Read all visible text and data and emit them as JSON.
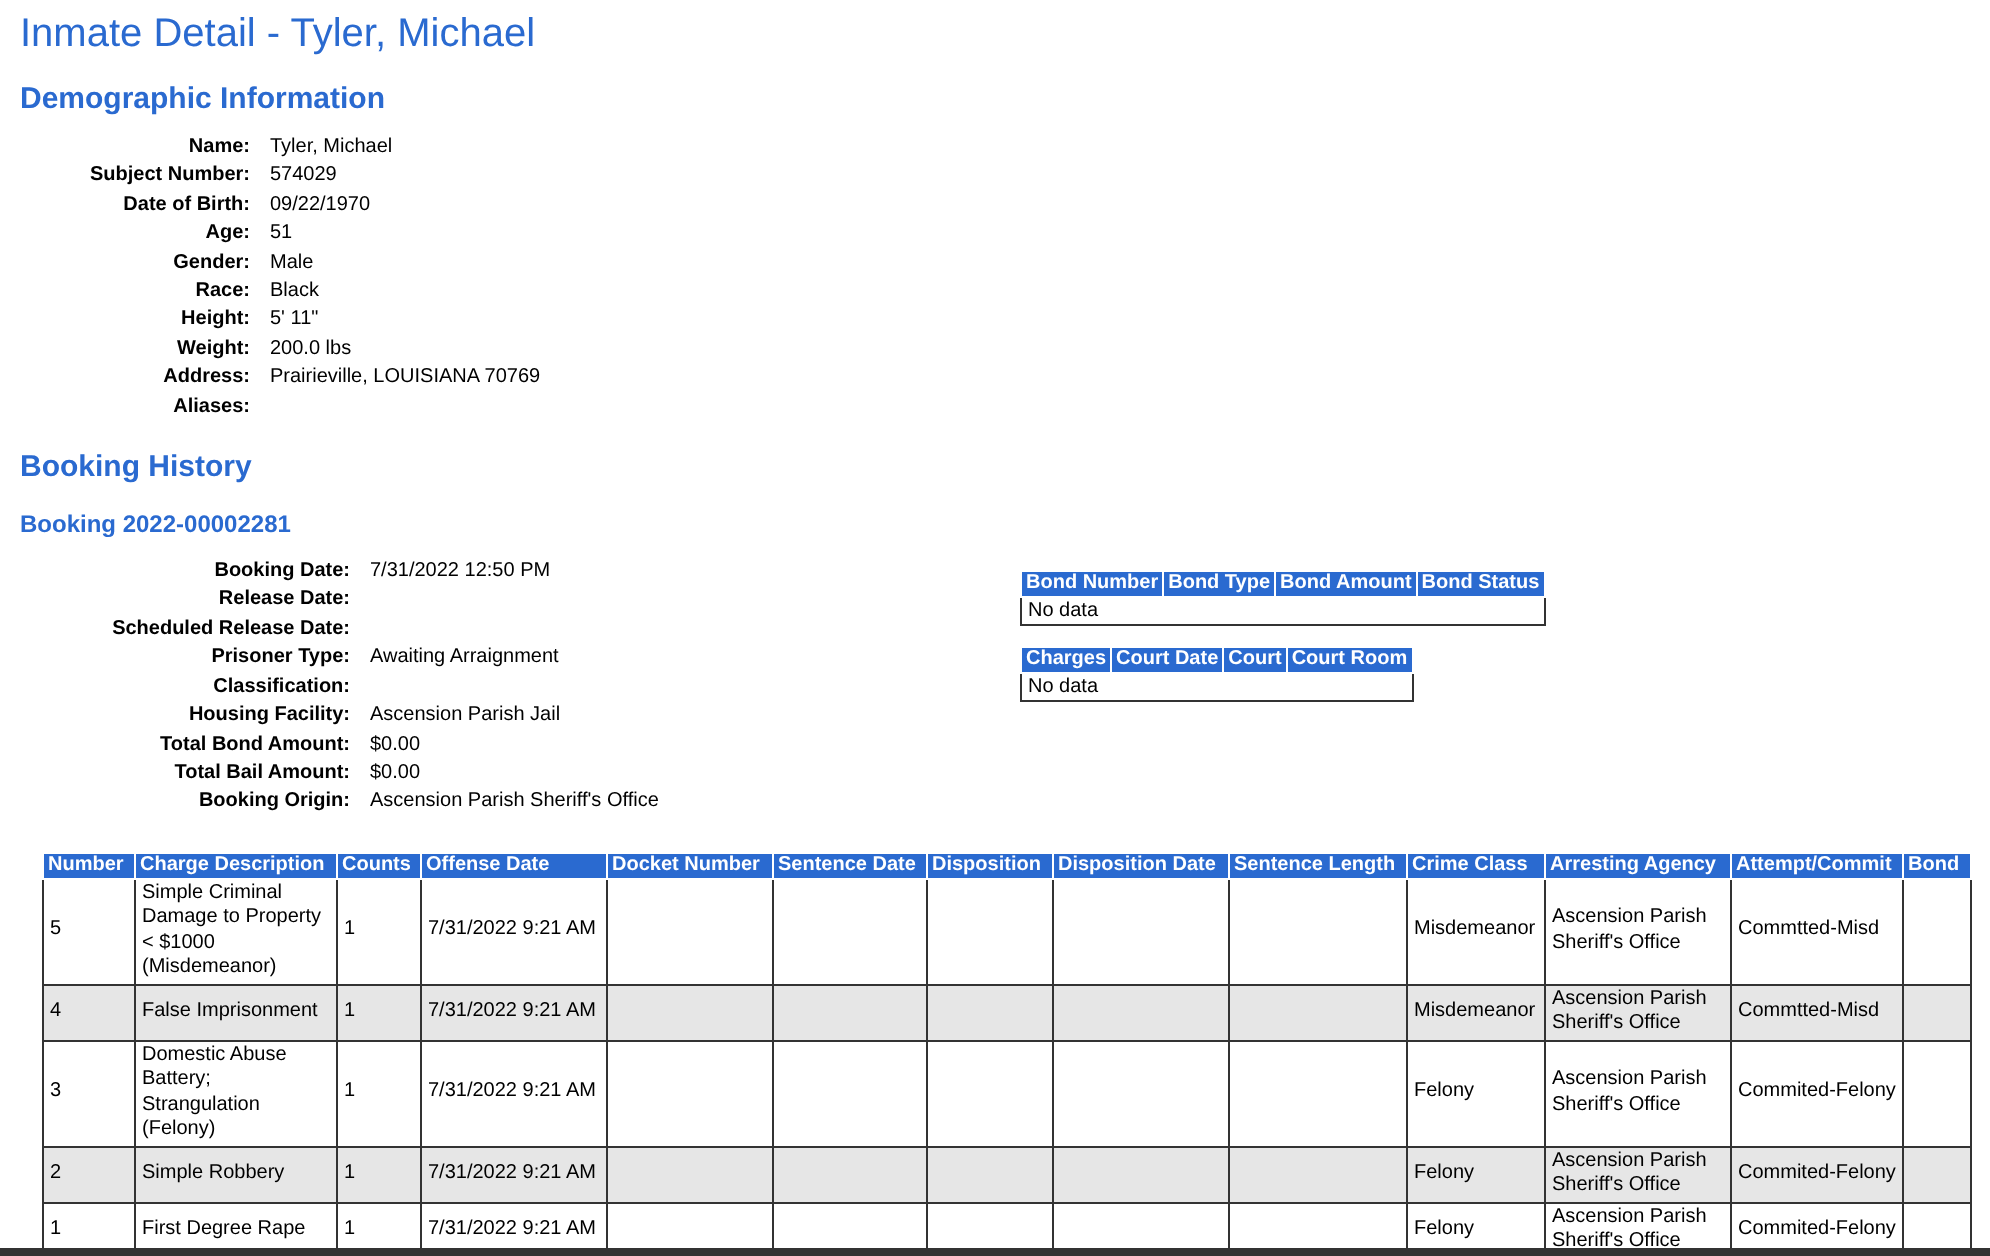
{
  "title": "Inmate Detail - Tyler, Michael",
  "demographics": {
    "heading": "Demographic Information",
    "fields": [
      {
        "label": "Name:",
        "value": "Tyler, Michael"
      },
      {
        "label": "Subject Number:",
        "value": "574029"
      },
      {
        "label": "Date of Birth:",
        "value": "09/22/1970"
      },
      {
        "label": "Age:",
        "value": "51"
      },
      {
        "label": "Gender:",
        "value": "Male"
      },
      {
        "label": "Race:",
        "value": "Black"
      },
      {
        "label": "Height:",
        "value": "5' 11\""
      },
      {
        "label": "Weight:",
        "value": "200.0 lbs"
      },
      {
        "label": "Address:",
        "value": "Prairieville, LOUISIANA 70769"
      },
      {
        "label": "Aliases:"
      }
    ]
  },
  "booking_history": {
    "heading": "Booking History",
    "booking": {
      "title": "Booking 2022-00002281",
      "fields": [
        {
          "label": "Booking Date:",
          "value": "7/31/2022 12:50 PM"
        },
        {
          "label": "Release Date:"
        },
        {
          "label": "Scheduled Release Date:"
        },
        {
          "label": "Prisoner Type:",
          "value": "Awaiting Arraignment"
        },
        {
          "label": "Classification:"
        },
        {
          "label": "Housing Facility:",
          "value": "Ascension Parish Jail"
        },
        {
          "label": "Total Bond Amount:",
          "value": "$0.00"
        },
        {
          "label": "Total Bail Amount:",
          "value": "$0.00"
        },
        {
          "label": "Booking Origin:",
          "value": "Ascension Parish Sheriff's Office"
        }
      ],
      "bond_table": {
        "columns": [
          "Bond Number",
          "Bond Type",
          "Bond Amount",
          "Bond Status"
        ],
        "empty_text": "No data"
      },
      "court_table": {
        "columns": [
          "Charges",
          "Court Date",
          "Court",
          "Court Room"
        ],
        "empty_text": "No data"
      },
      "charges_table": {
        "columns": [
          "Number",
          "Charge Description",
          "Counts",
          "Offense Date",
          "Docket Number",
          "Sentence Date",
          "Disposition",
          "Disposition Date",
          "Sentence Length",
          "Crime Class",
          "Arresting Agency",
          "Attempt/Commit",
          "Bond"
        ],
        "rows": [
          {
            "number": "5",
            "charge_description": "Simple Criminal Damage to Property < $1000 (Misdemeanor)",
            "counts": "1",
            "offense_date": "7/31/2022 9:21 AM",
            "crime_class": "Misdemeanor",
            "arresting_agency": "Ascension Parish Sheriff's Office",
            "attempt_commit": "Commtted-Misd"
          },
          {
            "number": "4",
            "charge_description": "False Imprisonment",
            "counts": "1",
            "offense_date": "7/31/2022 9:21 AM",
            "crime_class": "Misdemeanor",
            "arresting_agency": "Ascension Parish Sheriff's Office",
            "attempt_commit": "Commtted-Misd"
          },
          {
            "number": "3",
            "charge_description": "Domestic Abuse Battery; Strangulation (Felony)",
            "counts": "1",
            "offense_date": "7/31/2022 9:21 AM",
            "crime_class": "Felony",
            "arresting_agency": "Ascension Parish Sheriff's Office",
            "attempt_commit": "Commited-Felony"
          },
          {
            "number": "2",
            "charge_description": "Simple Robbery",
            "counts": "1",
            "offense_date": "7/31/2022 9:21 AM",
            "crime_class": "Felony",
            "arresting_agency": "Ascension Parish Sheriff's Office",
            "attempt_commit": "Commited-Felony"
          },
          {
            "number": "1",
            "charge_description": "First Degree Rape",
            "counts": "1",
            "offense_date": "7/31/2022 9:21 AM",
            "crime_class": "Felony",
            "arresting_agency": "Ascension Parish Sheriff's Office",
            "attempt_commit": "Commited-Felony"
          }
        ]
      }
    }
  }
}
